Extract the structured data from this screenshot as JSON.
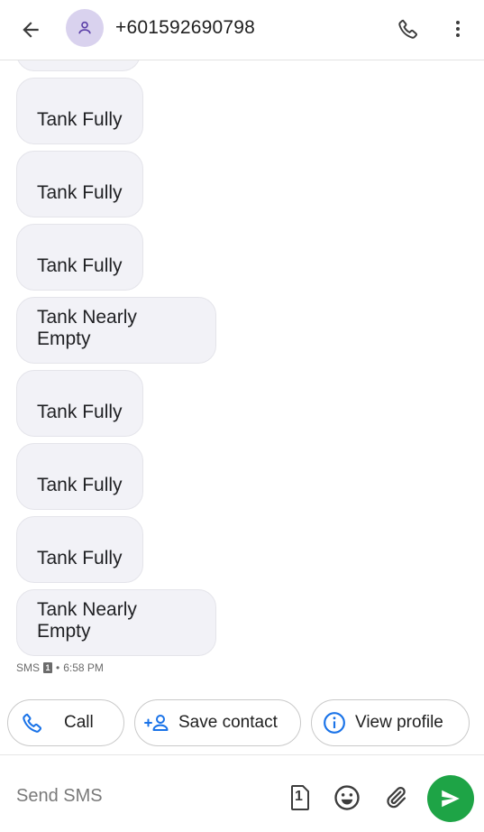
{
  "header": {
    "title": "+601592690798",
    "back_icon": "arrow-left-icon",
    "avatar_icon": "person-icon",
    "call_icon": "phone-icon",
    "more_icon": "more-vert-icon"
  },
  "messages": [
    {
      "text": "Tank Fully"
    },
    {
      "text": "Tank Fully"
    },
    {
      "text": "Tank Fully"
    },
    {
      "text": "Tank Nearly Empty"
    },
    {
      "text": "Tank Fully"
    },
    {
      "text": "Tank Fully"
    },
    {
      "text": "Tank Fully"
    },
    {
      "text": "Tank Nearly Empty"
    }
  ],
  "meta": {
    "channel": "SMS",
    "sim": "1",
    "separator": "•",
    "time": "6:58 PM"
  },
  "actions": {
    "call_label": "Call",
    "save_contact_label": "Save contact",
    "view_profile_label": "View profile"
  },
  "composer": {
    "placeholder": "Send SMS",
    "sim_label": "1",
    "emoji_icon": "emoji-icon",
    "attach_icon": "paperclip-icon",
    "send_icon": "send-icon"
  },
  "colors": {
    "bubble_bg": "#f2f2f7",
    "accent_blue": "#1a73e8",
    "send_green": "#1ea446",
    "avatar_bg": "#d9d2ee"
  }
}
